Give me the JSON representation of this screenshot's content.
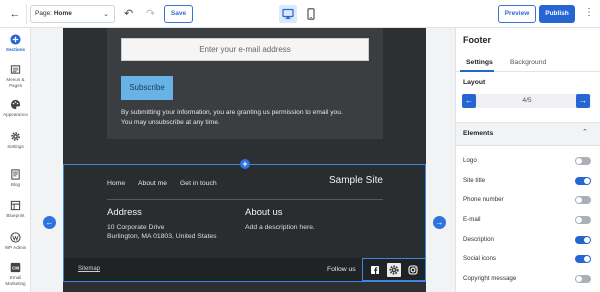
{
  "topbar": {
    "page_prefix": "Page:",
    "page_name": "Home",
    "save_label": "Save",
    "preview_label": "Preview",
    "publish_label": "Publish"
  },
  "leftnav": {
    "items": [
      {
        "label": "Sections",
        "icon": "plus-circle-icon",
        "active": true
      },
      {
        "label": "Menus & Pages",
        "icon": "menu-pages-icon",
        "active": false
      },
      {
        "label": "Appearance",
        "icon": "palette-icon",
        "active": false
      },
      {
        "label": "Settings",
        "icon": "gear-icon",
        "active": false
      },
      {
        "label": "Blog",
        "icon": "blog-icon",
        "active": false
      },
      {
        "label": "Blueprint",
        "icon": "blueprint-icon",
        "active": false
      },
      {
        "label": "WP Admin",
        "icon": "wordpress-icon",
        "active": false
      },
      {
        "label": "Email Marketing",
        "icon": "cm-icon",
        "active": false
      }
    ]
  },
  "newsletter": {
    "email_placeholder": "Enter your e-mail address",
    "subscribe_label": "Subscribe",
    "consent_line1": "By submitting your information, you are granting us permission to email you.",
    "consent_line2": "You may unsubscribe at any time."
  },
  "footer": {
    "nav": [
      "Home",
      "About me",
      "Get in touch"
    ],
    "site_title": "Sample Site",
    "address_heading": "Address",
    "address_line1": "10 Corporate Drive",
    "address_line2": "Burlington, MA 01803, United States",
    "about_heading": "About us",
    "about_desc": "Add a description here.",
    "sitemap": "Sitemap",
    "follow_us": "Follow us",
    "social_icons": [
      "facebook-icon",
      "gear-icon",
      "instagram-icon"
    ]
  },
  "panel": {
    "title": "Footer",
    "tabs": [
      "Settings",
      "Background"
    ],
    "active_tab": "Settings",
    "layout_label": "Layout",
    "layout_value": "4/5",
    "elements_label": "Elements",
    "elements": [
      {
        "label": "Logo",
        "on": false
      },
      {
        "label": "Site title",
        "on": true
      },
      {
        "label": "Phone number",
        "on": false
      },
      {
        "label": "E-mail",
        "on": false
      },
      {
        "label": "Description",
        "on": true
      },
      {
        "label": "Social icons",
        "on": true
      },
      {
        "label": "Copyright message",
        "on": false
      }
    ]
  },
  "colors": {
    "accent": "#2566d3",
    "canvas_dark": "#2d3032",
    "subscribe": "#67b3e6"
  }
}
